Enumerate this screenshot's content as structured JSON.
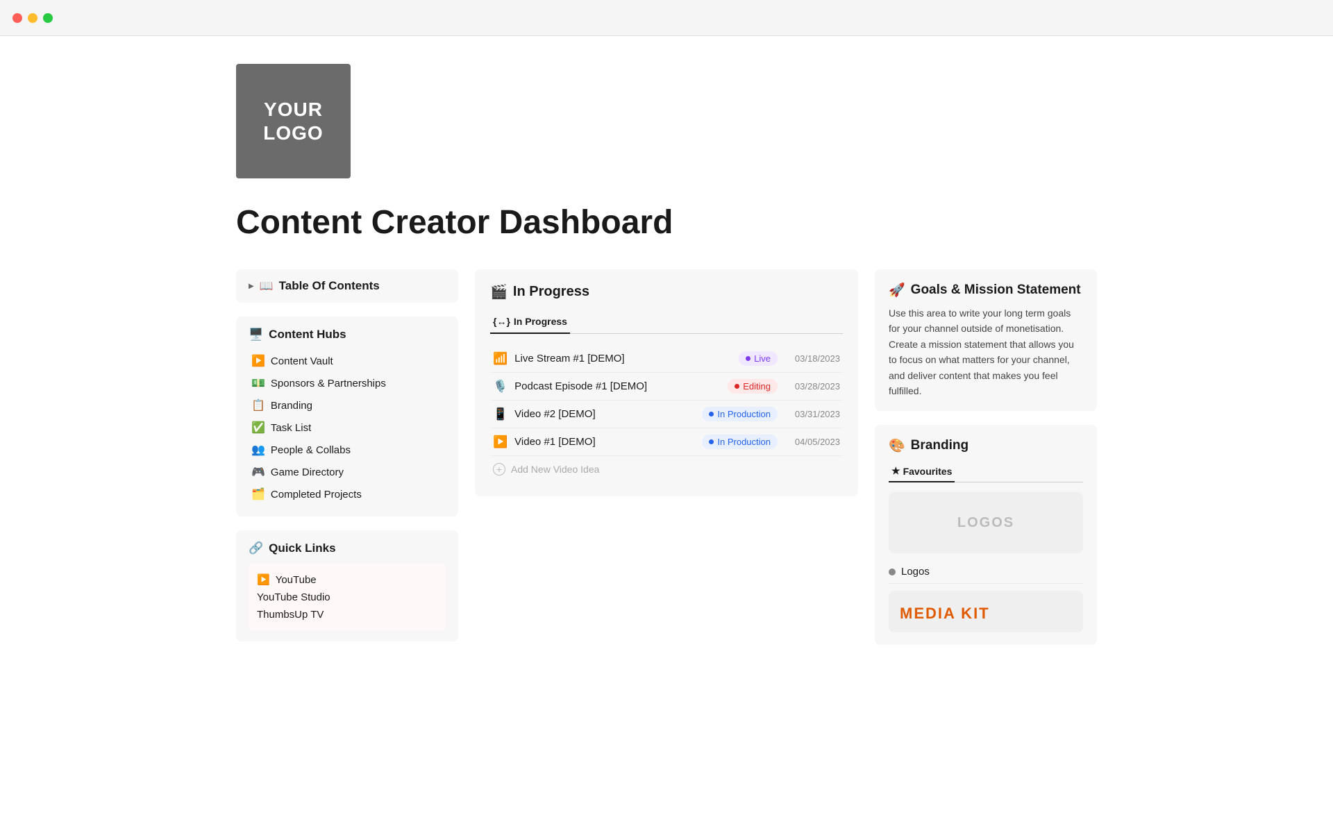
{
  "window": {
    "dots": [
      "red",
      "yellow",
      "green"
    ]
  },
  "logo": {
    "line1": "YOUR",
    "line2": "LOGO"
  },
  "page_title": "Content Creator Dashboard",
  "left": {
    "toc": {
      "arrow": "▶",
      "icon": "📖",
      "label": "Table Of Contents"
    },
    "content_hubs": {
      "icon": "🖥️",
      "title": "Content Hubs",
      "items": [
        {
          "icon": "▶️",
          "label": "Content Vault"
        },
        {
          "icon": "💵",
          "label": "Sponsors & Partnerships"
        },
        {
          "icon": "📋",
          "label": "Branding"
        },
        {
          "icon": "✅",
          "label": "Task List"
        },
        {
          "icon": "👥",
          "label": "People & Collabs"
        },
        {
          "icon": "🎮",
          "label": "Game Directory"
        },
        {
          "icon": "🗂️",
          "label": "Completed Projects"
        }
      ]
    },
    "quick_links": {
      "icon": "🔗",
      "title": "Quick Links",
      "items": [
        {
          "icon": "▶️",
          "label": "YouTube"
        },
        {
          "label": "YouTube Studio"
        },
        {
          "label": "ThumbsUp TV"
        }
      ]
    }
  },
  "middle": {
    "in_progress": {
      "icon": "🎬",
      "title": "In Progress",
      "tabs": [
        {
          "icon": "{↔}",
          "label": "In Progress",
          "active": true
        }
      ],
      "rows": [
        {
          "icon": "📶",
          "title": "Live Stream #1 [DEMO]",
          "status": "Live",
          "badge_type": "live",
          "date": "03/18/2023"
        },
        {
          "icon": "🎙️",
          "title": "Podcast Episode #1 [DEMO]",
          "status": "Editing",
          "badge_type": "editing",
          "date": "03/28/2023"
        },
        {
          "icon": "📱",
          "title": "Video #2 [DEMO]",
          "status": "In Production",
          "badge_type": "production",
          "date": "03/31/2023"
        },
        {
          "icon": "▶️",
          "title": "Video #1 [DEMO]",
          "status": "In Production",
          "badge_type": "production",
          "date": "04/05/2023"
        }
      ],
      "add_label": "Add New Video Idea"
    }
  },
  "right": {
    "goals": {
      "icon": "🚀",
      "title": "Goals & Mission Statement",
      "text": "Use this area to write your long term goals for your channel outside of monetisation. Create a mission statement that allows you to focus on what matters for your channel, and deliver content that makes you feel fulfilled."
    },
    "branding": {
      "icon": "🎨",
      "title": "Branding",
      "tab_icon": "★",
      "tab_label": "Favourites",
      "logos_placeholder": "LOGOS",
      "logos_item": "Logos",
      "media_kit_label": "MEDIA KIT"
    }
  }
}
